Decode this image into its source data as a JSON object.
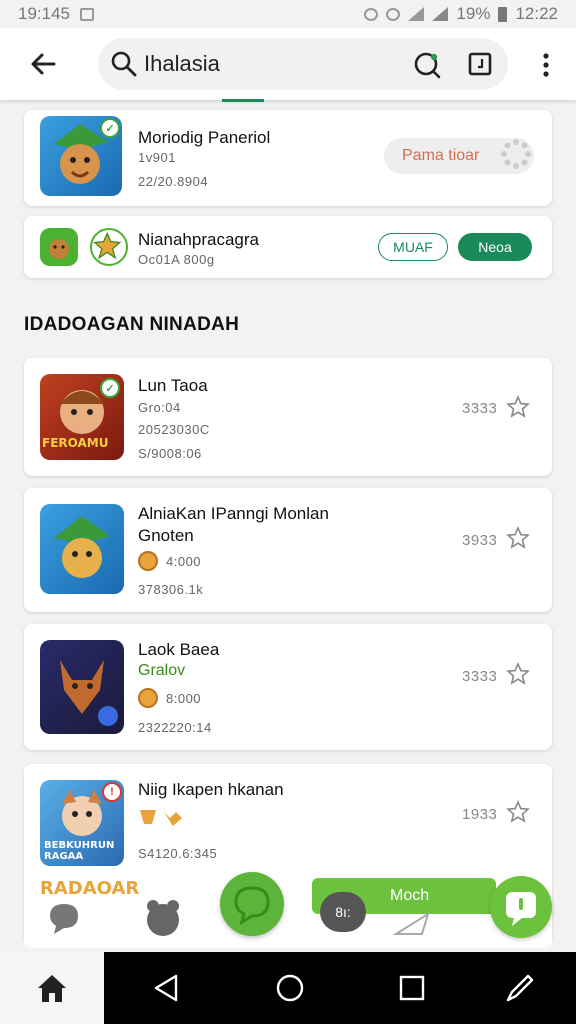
{
  "status_bar": {
    "time_left": "19:145",
    "battery": "19%",
    "time_right": "12:22"
  },
  "search": {
    "query": "Ihalasia"
  },
  "top_results": [
    {
      "title": "Moriodig Paneriol",
      "line2": "1v901",
      "line3": "22/20.8904",
      "action": "Pama tioar"
    },
    {
      "title": "Nianahpracagra",
      "line2": "Oc01A 800g",
      "btn_outline": "MUAF",
      "btn_solid": "Neoa"
    }
  ],
  "section": {
    "title": "IDADOAGAN NINADAH"
  },
  "apps": [
    {
      "title": "Lun Taoa",
      "line2": "Gro:04",
      "line3": "20523030C",
      "line4": "S/9008:06",
      "score": "3333",
      "icon_text": "FEROAMU",
      "badge": "green"
    },
    {
      "title": "AlniaKan IPanngi Monlan",
      "title2": "Gnoten",
      "rating": "4:000",
      "line4": "378306.1k",
      "score": "3933",
      "badge": ""
    },
    {
      "title": "Laok Baea",
      "green": "Gralov",
      "rating": "8:000",
      "line4": "2322220:14",
      "score": "3333",
      "badge": ""
    },
    {
      "title": "Niig Ikapen hkanan",
      "line4": "S4120.6:345",
      "score": "1933",
      "icon_text": "BEBKUHRUN RAGAA",
      "badge": "red"
    }
  ],
  "dock": {
    "mode_label": "Moch",
    "mode_icon_text": "8ı:",
    "ghost_text": "RADAOAR"
  },
  "colors": {
    "accent": "#1a8a5a",
    "green": "#6cc23c",
    "pending_text": "#d07050"
  },
  "icons": [
    "back-arrow-icon",
    "search-icon",
    "voice-search-icon",
    "scan-icon",
    "more-vert-icon",
    "star-icon",
    "coin-icon",
    "home-icon",
    "back-triangle-icon",
    "circle-home-icon",
    "square-recents-icon",
    "pen-icon"
  ]
}
